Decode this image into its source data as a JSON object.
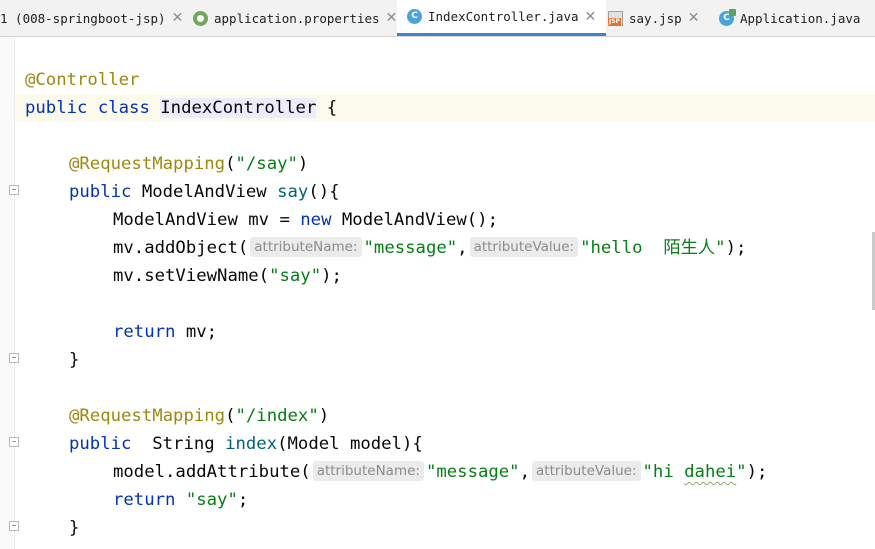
{
  "tabs": [
    {
      "label": "1 (008-springboot-jsp)",
      "icon": "module-icon",
      "active": false
    },
    {
      "label": "application.properties",
      "icon": "spring-properties-icon",
      "active": false
    },
    {
      "label": "IndexController.java",
      "icon": "java-class-icon",
      "active": true
    },
    {
      "label": "say.jsp",
      "icon": "jsp-file-icon",
      "active": false
    },
    {
      "label": "Application.java",
      "icon": "spring-boot-app-icon",
      "active": false
    }
  ],
  "close_glyph": "✕",
  "code": {
    "l1_annotation": "@Controller",
    "l2_kw_public": "public",
    "l2_kw_class": "class",
    "l2_class_name": "IndexController",
    "l2_brace": " {",
    "l4_annotation": "@RequestMapping",
    "l4_open": "(",
    "l4_path": "\"/say\"",
    "l4_close": ")",
    "l5_kw_public": "public",
    "l5_type": " ModelAndView ",
    "l5_method": "say",
    "l5_rest": "(){",
    "l6_a": "ModelAndView mv = ",
    "l6_kw_new": "new",
    "l6_b": " ModelAndView();",
    "l7_a": "mv.addObject(",
    "l7_hint1": "attributeName:",
    "l7_str1": "\"message\"",
    "l7_comma": ",",
    "l7_hint2": "attributeValue:",
    "l7_str2": "\"hello  陌生人\"",
    "l7_end": ");",
    "l8_a": "mv.setViewName(",
    "l8_str": "\"say\"",
    "l8_end": ");",
    "l10_kw_return": "return",
    "l10_rest": " mv;",
    "l11_brace": "}",
    "l13_annotation": "@RequestMapping",
    "l13_open": "(",
    "l13_path": "\"/index\"",
    "l13_close": ")",
    "l14_kw_public": "public",
    "l14_type": "  String ",
    "l14_method": "index",
    "l14_rest": "(Model model){",
    "l15_a": "model.addAttribute(",
    "l15_hint1": "attributeName:",
    "l15_str1": "\"message\"",
    "l15_comma": ",",
    "l15_hint2": "attributeValue:",
    "l15_str2_a": "\"hi ",
    "l15_str2_typo": "dahei",
    "l15_str2_b": "\"",
    "l15_end": ");",
    "l16_kw_return": "return",
    "l16_space": " ",
    "l16_str": "\"say\"",
    "l16_end": ";",
    "l17_brace": "}"
  }
}
